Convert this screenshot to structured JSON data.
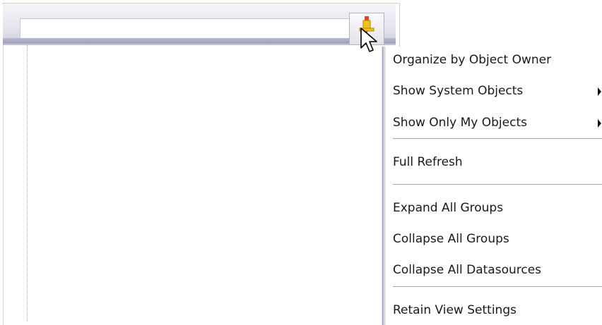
{
  "search": {
    "value": "",
    "placeholder": ""
  },
  "toolbar": {
    "view_options_icon": "pin-icon"
  },
  "context_menu": {
    "items": [
      {
        "label": "Organize by Object Owner",
        "has_submenu": false
      },
      {
        "label": "Show System Objects",
        "has_submenu": true
      },
      {
        "label": "Show Only My Objects",
        "has_submenu": true
      },
      {
        "label": "Full Refresh",
        "has_submenu": false
      },
      {
        "label": "Expand All Groups",
        "has_submenu": false
      },
      {
        "label": "Collapse All Groups",
        "has_submenu": false
      },
      {
        "label": "Collapse All Datasources",
        "has_submenu": false
      },
      {
        "label": "Retain View Settings",
        "has_submenu": false
      }
    ]
  },
  "colors": {
    "menu_text": "#1a1a1a",
    "pin_yellow": "#f2c21a",
    "pin_red": "#c0392b",
    "band": "#9e9ebc"
  }
}
